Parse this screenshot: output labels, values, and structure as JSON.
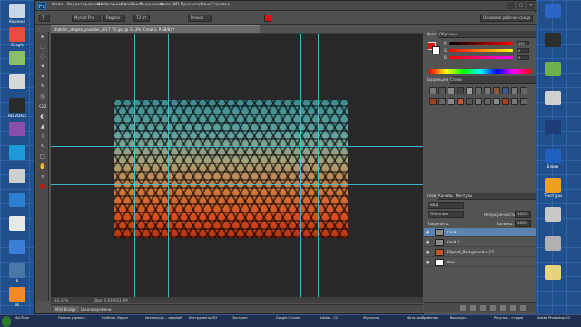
{
  "desktop": {
    "left_icons": [
      {
        "label": "Корзина",
        "color": "#c9d6e6"
      },
      {
        "label": "Google",
        "color": "#e84c3d"
      },
      {
        "label": "",
        "color": "#8bbf6a"
      },
      {
        "label": "",
        "color": "#d8d8d8"
      },
      {
        "label": "HD VDeck",
        "color": "#2a2a2a"
      },
      {
        "label": "",
        "color": "#8a4fa8"
      },
      {
        "label": "",
        "color": "#1e9ad6"
      },
      {
        "label": "",
        "color": "#cfcfcf"
      },
      {
        "label": "",
        "color": "#2f7fd0"
      },
      {
        "label": "",
        "color": "#e8e8e8"
      },
      {
        "label": "",
        "color": "#3b7dd8"
      },
      {
        "label": "В",
        "color": "#4a76a8"
      },
      {
        "label": "ok",
        "color": "#f2892b"
      }
    ],
    "right_icons": [
      {
        "label": "",
        "color": "#2a66c8"
      },
      {
        "label": "",
        "color": "#2d2d2d"
      },
      {
        "label": "",
        "color": "#6fb04d"
      },
      {
        "label": "",
        "color": "#d0d0d0"
      },
      {
        "label": "",
        "color": "#1d3c78"
      },
      {
        "label": "Блоки",
        "color": "#1f5fbf"
      },
      {
        "label": "Текстуры",
        "color": "#f0a020"
      },
      {
        "label": "",
        "color": "#c8c8c8"
      },
      {
        "label": "",
        "color": "#b0b0b0"
      },
      {
        "label": "",
        "color": "#e8d27a"
      }
    ]
  },
  "ps": {
    "logo": "Ps",
    "menus": [
      "Файл",
      "Редактирование",
      "Изображение",
      "Слои",
      "Текст",
      "Выделение",
      "Фильтр",
      "3D",
      "Просмотр",
      "Окно",
      "Справка"
    ],
    "window_controls": [
      "–",
      "□",
      "✕"
    ],
    "options": {
      "font": "Myriad Pro",
      "style": "Regular",
      "size": "72 пт",
      "aa": "Резкое",
      "workspace": "Основная рабочая среда"
    },
    "doc_tab": "shablon_shapka_youtube_2017 ТО.jpg @ 33,3% (Слой 1, RGB/8) *",
    "status": {
      "zoom": "33,33%",
      "doc": "Док: 5,93M/23,9M"
    },
    "bottom_tabs": [
      "Mini Bridge",
      "Шкала времени"
    ],
    "tools": [
      "▸",
      "⬚",
      "◌",
      "✦",
      "⌗",
      "✎",
      "⎘",
      "⌫",
      "◐",
      "▲",
      "T",
      "↖",
      "□",
      "✋",
      "⌕",
      "■"
    ],
    "accent": "#3fc3d6"
  },
  "panels": {
    "color_tabs": [
      "Цвет",
      "Образцы"
    ],
    "rgb": [
      {
        "label": "R",
        "value": "255",
        "gradient": "linear-gradient(90deg,#000,#f00)"
      },
      {
        "label": "G",
        "value": "0",
        "gradient": "linear-gradient(90deg,#f00,#ff0)"
      },
      {
        "label": "B",
        "value": "0",
        "gradient": "linear-gradient(90deg,#f00,#f0f)"
      }
    ],
    "adj_tabs": [
      "Коррекция",
      "Стили"
    ],
    "layers_tabs": [
      "Слои",
      "Каналы",
      "Контуры"
    ],
    "layers_filter": "Вид",
    "blend_mode": "Обычные",
    "opacity_label": "Непрозрачность:",
    "opacity": "100%",
    "lock_label": "Закрепить:",
    "fill_label": "Заливка:",
    "fill": "100%",
    "layers": [
      {
        "name": "Слой 1",
        "thumb": "#8a8a8a",
        "selected": true
      },
      {
        "name": "Слой 2",
        "thumb": "#8a8a8a",
        "selected": false
      },
      {
        "name": "Ellipsed_Background-4-12",
        "thumb": "#c05a28",
        "selected": false
      },
      {
        "name": "Фон",
        "thumb": "#ffffff",
        "selected": false
      }
    ]
  },
  "taskbar": {
    "items": [
      "MyUTube",
      "Панель управл...",
      "Учебное, Видео",
      "Автозагруз... заданий",
      "Инструменты 3D",
      "Экстракт",
      "Google Chrome",
      "Adobe... CC",
      "Журналы",
      "Фото-изображение",
      "Ваш курс...",
      "Рисунок... студия",
      "Adobe Photoshop CC"
    ]
  }
}
